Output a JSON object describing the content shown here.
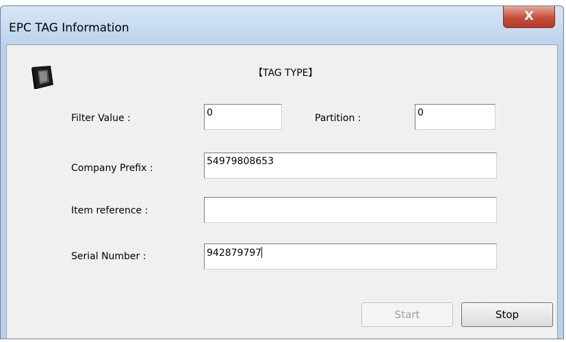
{
  "window": {
    "title": "EPC TAG Information",
    "close_label": "X"
  },
  "form": {
    "heading": "【TAG TYPE】",
    "filter_value": {
      "label": "Filter Value :",
      "value": "0"
    },
    "partition": {
      "label": "Partition :",
      "value": "0"
    },
    "company_prefix": {
      "label": "Company Prefix :",
      "value": "54979808653"
    },
    "item_reference": {
      "label": "Item reference :",
      "value": ""
    },
    "serial_number": {
      "label": "Serial Number :",
      "value": "942879797"
    }
  },
  "buttons": {
    "start": "Start",
    "stop": "Stop"
  }
}
